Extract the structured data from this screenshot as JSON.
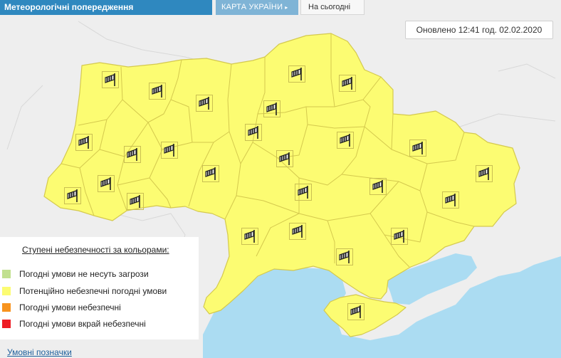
{
  "header": {
    "title": "Метеорологічні попередження",
    "map_tab": "КАРТА УКРАЇНИ",
    "map_tab_arrow": "▸",
    "today_tab": "На сьогодні"
  },
  "updated": "Оновлено 12:41 год. 02.02.2020",
  "legend": {
    "title": "Ступені небезпечності за кольорами:",
    "items": [
      {
        "label": "Погодні умови не несуть загрози",
        "color": "#c1e08f"
      },
      {
        "label": "Потенційно небезпечні погодні умови",
        "color": "#fcfc72"
      },
      {
        "label": "Погодні умови небезпечні",
        "color": "#f7931e"
      },
      {
        "label": "Погодні умови вкрай небезпечні",
        "color": "#ee1c24"
      }
    ]
  },
  "symbols_link": "Умовні позначки",
  "map": {
    "region_color": "#fcfc72",
    "border_color": "#d4c94e",
    "sea_color": "#abdcf2",
    "land_color": "#eeeeee",
    "warning_icon": "windsock-icon",
    "warning_count": 25
  }
}
